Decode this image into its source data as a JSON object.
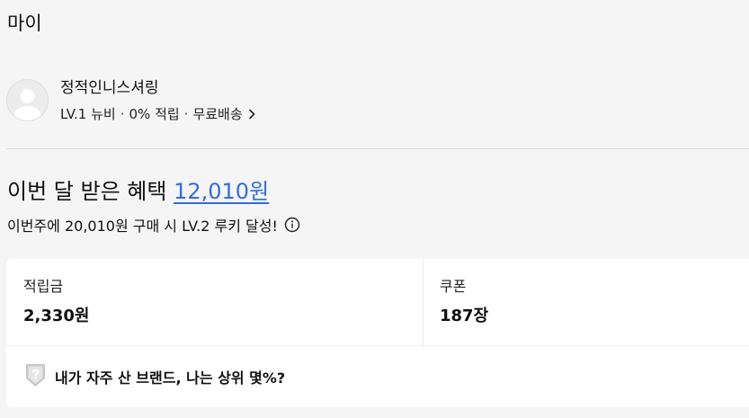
{
  "header": {
    "title": "마이"
  },
  "profile": {
    "name": "정적인니스셔링",
    "level": "LV.1 뉴비",
    "rate": "0% 적립",
    "shipping": "무료배송",
    "separator": "·"
  },
  "benefit": {
    "heading": "이번 달 받은 혜택",
    "amount": "12,010원",
    "level_message": "이번주에 20,010원 구매 시 LV.2 루키 달성!"
  },
  "stats": {
    "points_label": "적립금",
    "points_value": "2,330원",
    "coupons_label": "쿠폰",
    "coupons_value": "187장"
  },
  "brand_rank": {
    "text": "내가 자주 산 브랜드, 나는 상위 몇%?"
  },
  "icons": {
    "avatar": "default-avatar-icon",
    "chevron": "chevron-right-icon",
    "info": "info-circle-icon",
    "badge": "shield-question-badge-icon"
  },
  "colors": {
    "accent": "#2e6de0",
    "background": "#f5f5f5",
    "card": "#ffffff"
  }
}
